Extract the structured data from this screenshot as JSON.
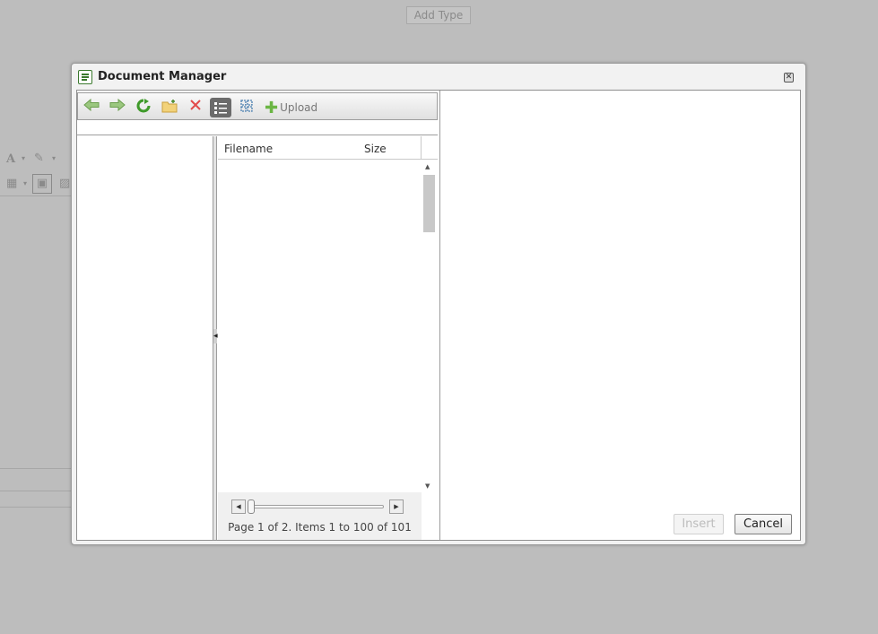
{
  "background": {
    "add_type_label": "Add Type"
  },
  "dialog": {
    "title": "Document Manager",
    "toolbar": {
      "buttons": [
        {
          "name": "back",
          "icon": "arrow-left-icon"
        },
        {
          "name": "forward",
          "icon": "arrow-right-icon"
        },
        {
          "name": "refresh",
          "icon": "refresh-icon"
        },
        {
          "name": "new-folder",
          "icon": "new-folder-icon"
        },
        {
          "name": "delete",
          "icon": "delete-icon"
        },
        {
          "name": "list-view",
          "icon": "list-view-icon",
          "active": true
        },
        {
          "name": "thumbnail-view",
          "icon": "thumbnails-icon"
        }
      ],
      "upload_label": "Upload"
    },
    "grid": {
      "columns": [
        "Filename",
        "Size"
      ],
      "rows": []
    },
    "pager": {
      "text": "Page 1 of 2. Items 1 to 100 of 101"
    },
    "buttons": {
      "insert_label": "Insert",
      "cancel_label": "Cancel"
    }
  },
  "colors": {
    "overlay": "#bdbdbd",
    "accent_green": "#6bb644",
    "delete_red": "#e24a4a"
  }
}
